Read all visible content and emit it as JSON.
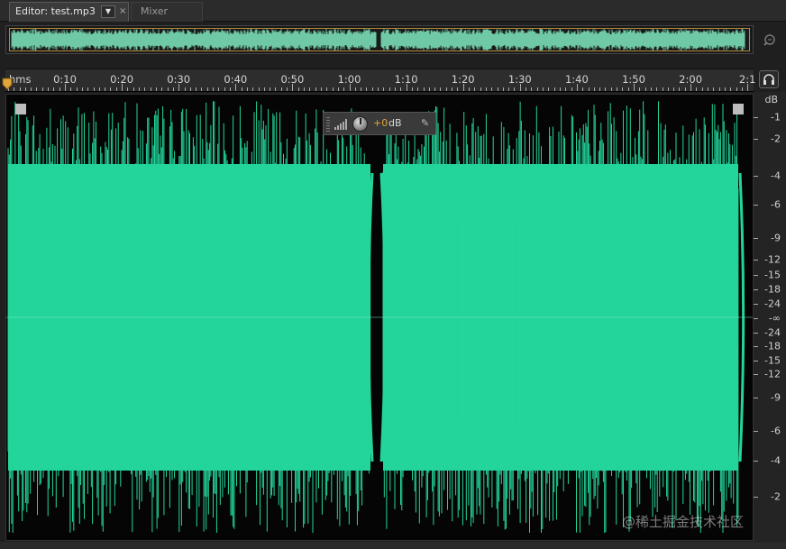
{
  "tabs": {
    "editor_label": "Editor: test.mp3",
    "dropdown_glyph": "▼",
    "close_glyph": "×",
    "mixer_label": "Mixer"
  },
  "ruler": {
    "unit_label": "hms",
    "labels": [
      "0:10",
      "0:20",
      "0:30",
      "0:40",
      "0:50",
      "1:00",
      "1:10",
      "1:20",
      "1:30",
      "1:40",
      "1:50",
      "2:00",
      "2:1"
    ]
  },
  "hud": {
    "gain_value": "+0",
    "gain_unit": "dB",
    "pin_glyph": "✎"
  },
  "db_scale": {
    "unit": "dB",
    "labels": [
      "-1",
      "-2",
      "-4",
      "-6",
      "-9",
      "-12",
      "-15",
      "-18",
      "-24",
      "-∞",
      "-24",
      "-18",
      "-15",
      "-12",
      "-9",
      "-6",
      "-4",
      "-2"
    ]
  },
  "watermark": "@稀土掘金技术社区",
  "colors": {
    "waveform": "#23d59b",
    "overview_waveform": "#6fc9a6",
    "accent": "#e2a63a"
  },
  "icons": {
    "zoom": "zoom-magnifier-icon",
    "headphones": "headphones-icon",
    "playhead": "playhead-marker-icon",
    "gain_knob": "gain-knob-icon",
    "pin": "pin-icon"
  }
}
